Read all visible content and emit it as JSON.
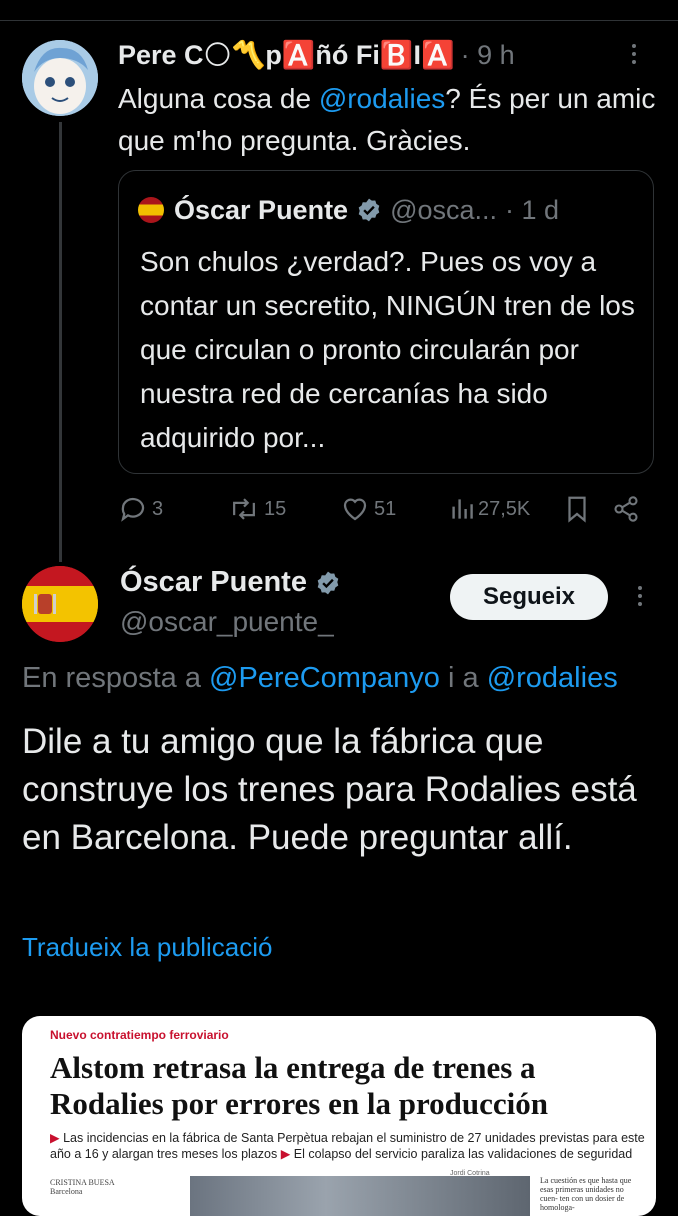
{
  "tweet1": {
    "name": "Pere C🌕〽️p🅰️ñó Fi🅱️I🅰️",
    "time": "· 9 h",
    "text_before": "Alguna cosa de ",
    "mention": "@rodalies",
    "text_after": "? És per un amic que m'ho pregunta. Gràcies.",
    "quote": {
      "name": "Óscar Puente",
      "handle": "@osca...",
      "time": "· 1 d",
      "text": "Son chulos ¿verdad?. Pues os voy a contar un secretito, NINGÚN tren de los que circulan o pronto circularán por nuestra red de cercanías ha sido adquirido por..."
    },
    "actions": {
      "replies": "3",
      "reposts": "15",
      "likes": "51",
      "views": "27,5K"
    }
  },
  "tweet2": {
    "name": "Óscar Puente",
    "handle": "@oscar_puente_",
    "follow_label": "Segueix",
    "reply_prefix": "En resposta a ",
    "reply_mention1": "@PereCompanyo",
    "reply_join": " i a ",
    "reply_mention2": "@rodalies",
    "text": "Dile a tu amigo que la fábrica que construye los trenes para Rodalies está en Barcelona. Puede preguntar allí.",
    "translate": "Tradueix la publicació"
  },
  "news": {
    "kicker": "Nuevo contratiempo ferroviario",
    "title": "Alstom retrasa la entrega de trenes a Rodalies por errores en la producción",
    "sub1": "Las incidencias en la fábrica de Santa Perpètua rebajan el suministro de 27 unidades previstas para este año a 16 y alargan tres meses los plazos",
    "sub2": "El colapso del servicio paraliza las validaciones de seguridad",
    "byline": "CRISTINA BUESA",
    "byline_city": "Barcelona",
    "photo_credit": "Jordi Cotrina",
    "sidecol": "La cuestión es que hasta que esas primeras unidades no cuen- ten con un dosier de homologa-"
  },
  "colors": {
    "background": "#000000",
    "text": "#e7e9ea",
    "muted": "#71767b",
    "accent": "#1d9bf0",
    "verified": "#829aab"
  }
}
